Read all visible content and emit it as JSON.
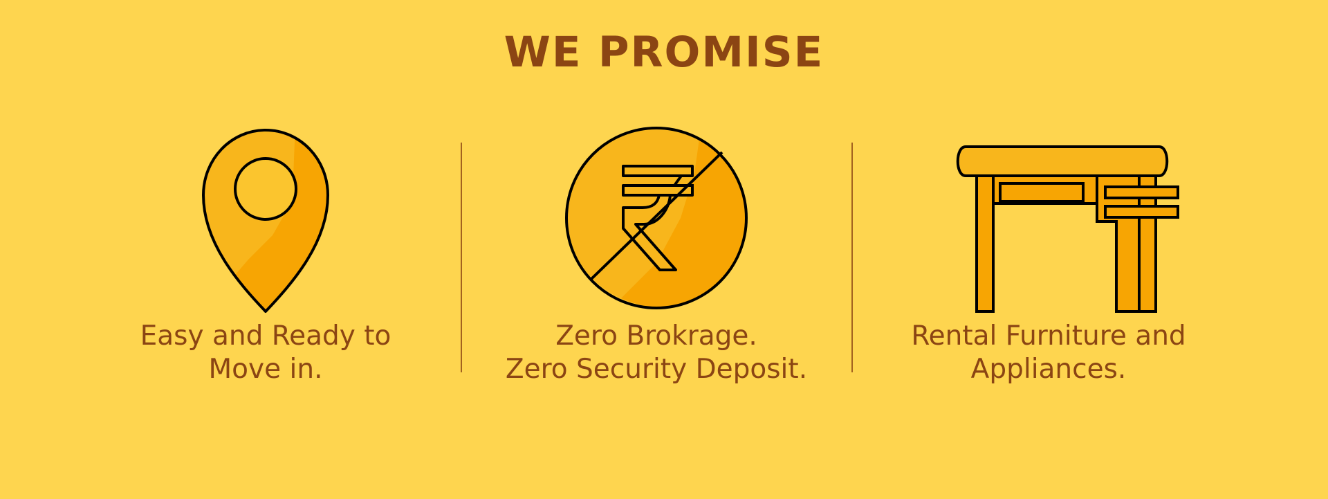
{
  "banner": {
    "title": "WE PROMISE",
    "features": [
      {
        "icon": "location-pin-icon",
        "line1": "Easy and Ready to",
        "line2": "Move in."
      },
      {
        "icon": "no-rupee-icon",
        "line1": "Zero Brokrage.",
        "line2": "Zero Security Deposit."
      },
      {
        "icon": "desk-icon",
        "line1": "Rental Furniture and",
        "line2": "Appliances."
      }
    ]
  },
  "colors": {
    "background": "#FED54F",
    "text": "#8B4513",
    "icon_light": "#FBC52E",
    "icon_mid": "#F8B61C",
    "icon_dark": "#F7A503",
    "outline": "#000000"
  }
}
